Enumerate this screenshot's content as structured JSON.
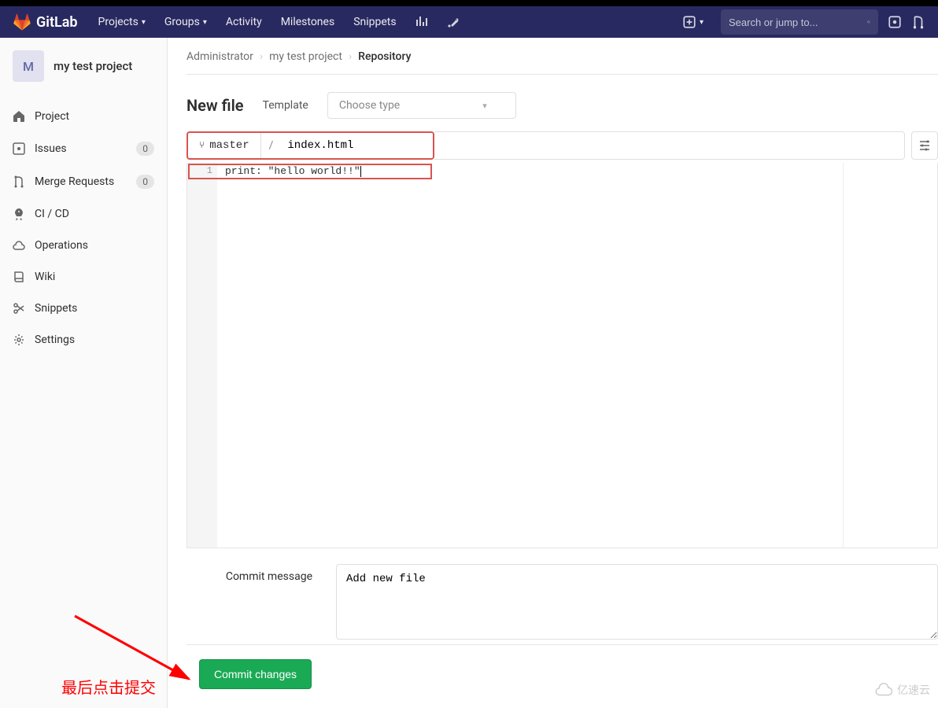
{
  "topbar": {
    "brand": "GitLab",
    "nav": {
      "projects": "Projects",
      "groups": "Groups",
      "activity": "Activity",
      "milestones": "Milestones",
      "snippets": "Snippets"
    },
    "search_placeholder": "Search or jump to..."
  },
  "sidebar": {
    "project_initial": "M",
    "project_name": "my test project",
    "items": [
      {
        "label": "Project",
        "icon": "home"
      },
      {
        "label": "Issues",
        "icon": "issues",
        "badge": "0"
      },
      {
        "label": "Merge Requests",
        "icon": "merge",
        "badge": "0"
      },
      {
        "label": "CI / CD",
        "icon": "rocket"
      },
      {
        "label": "Operations",
        "icon": "cloud"
      },
      {
        "label": "Wiki",
        "icon": "book"
      },
      {
        "label": "Snippets",
        "icon": "scissors"
      },
      {
        "label": "Settings",
        "icon": "gear"
      }
    ]
  },
  "breadcrumb": {
    "b1": "Administrator",
    "b2": "my test project",
    "b3": "Repository"
  },
  "page": {
    "title": "New file",
    "template_label": "Template",
    "template_placeholder": "Choose type",
    "branch": "master",
    "filename": "index.html",
    "code_line_1": "print: \"hello world!!\"",
    "line_number": "1",
    "commit_label": "Commit message",
    "commit_message": "Add new file",
    "commit_button": "Commit changes"
  },
  "annotation": {
    "text": "最后点击提交"
  },
  "watermark": "亿速云"
}
